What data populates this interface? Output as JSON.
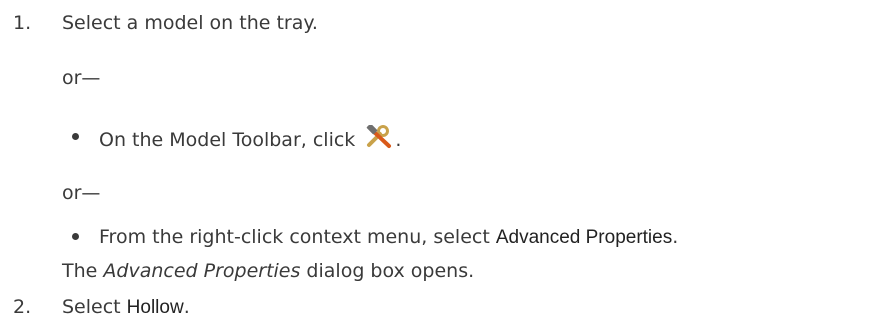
{
  "steps": [
    {
      "number": "1.",
      "text": "Select a model on the tray.",
      "or_1": "or—",
      "bullet_1": {
        "text_before": "On the Model Toolbar, click",
        "icon": "hammer-wrench-tools-icon",
        "text_after": "."
      },
      "or_2": "or—",
      "bullet_2": {
        "text_before": "From the right-click context menu, select",
        "ui_term": "Advanced Properties",
        "text_after": "."
      },
      "result": {
        "italic_term": "Advanced Properties",
        "text_after": " dialog box opens.",
        "text_before": "The "
      }
    },
    {
      "number": "2.",
      "text_before": "Select",
      "ui_term": "Hollow",
      "text_after": "."
    }
  ],
  "colors": {
    "body_text": "#3a3a3a",
    "ui_term": "#222222",
    "icon_wrench": "#c9a24a",
    "icon_handle": "#d95a1a",
    "icon_head": "#6f6f6f"
  }
}
